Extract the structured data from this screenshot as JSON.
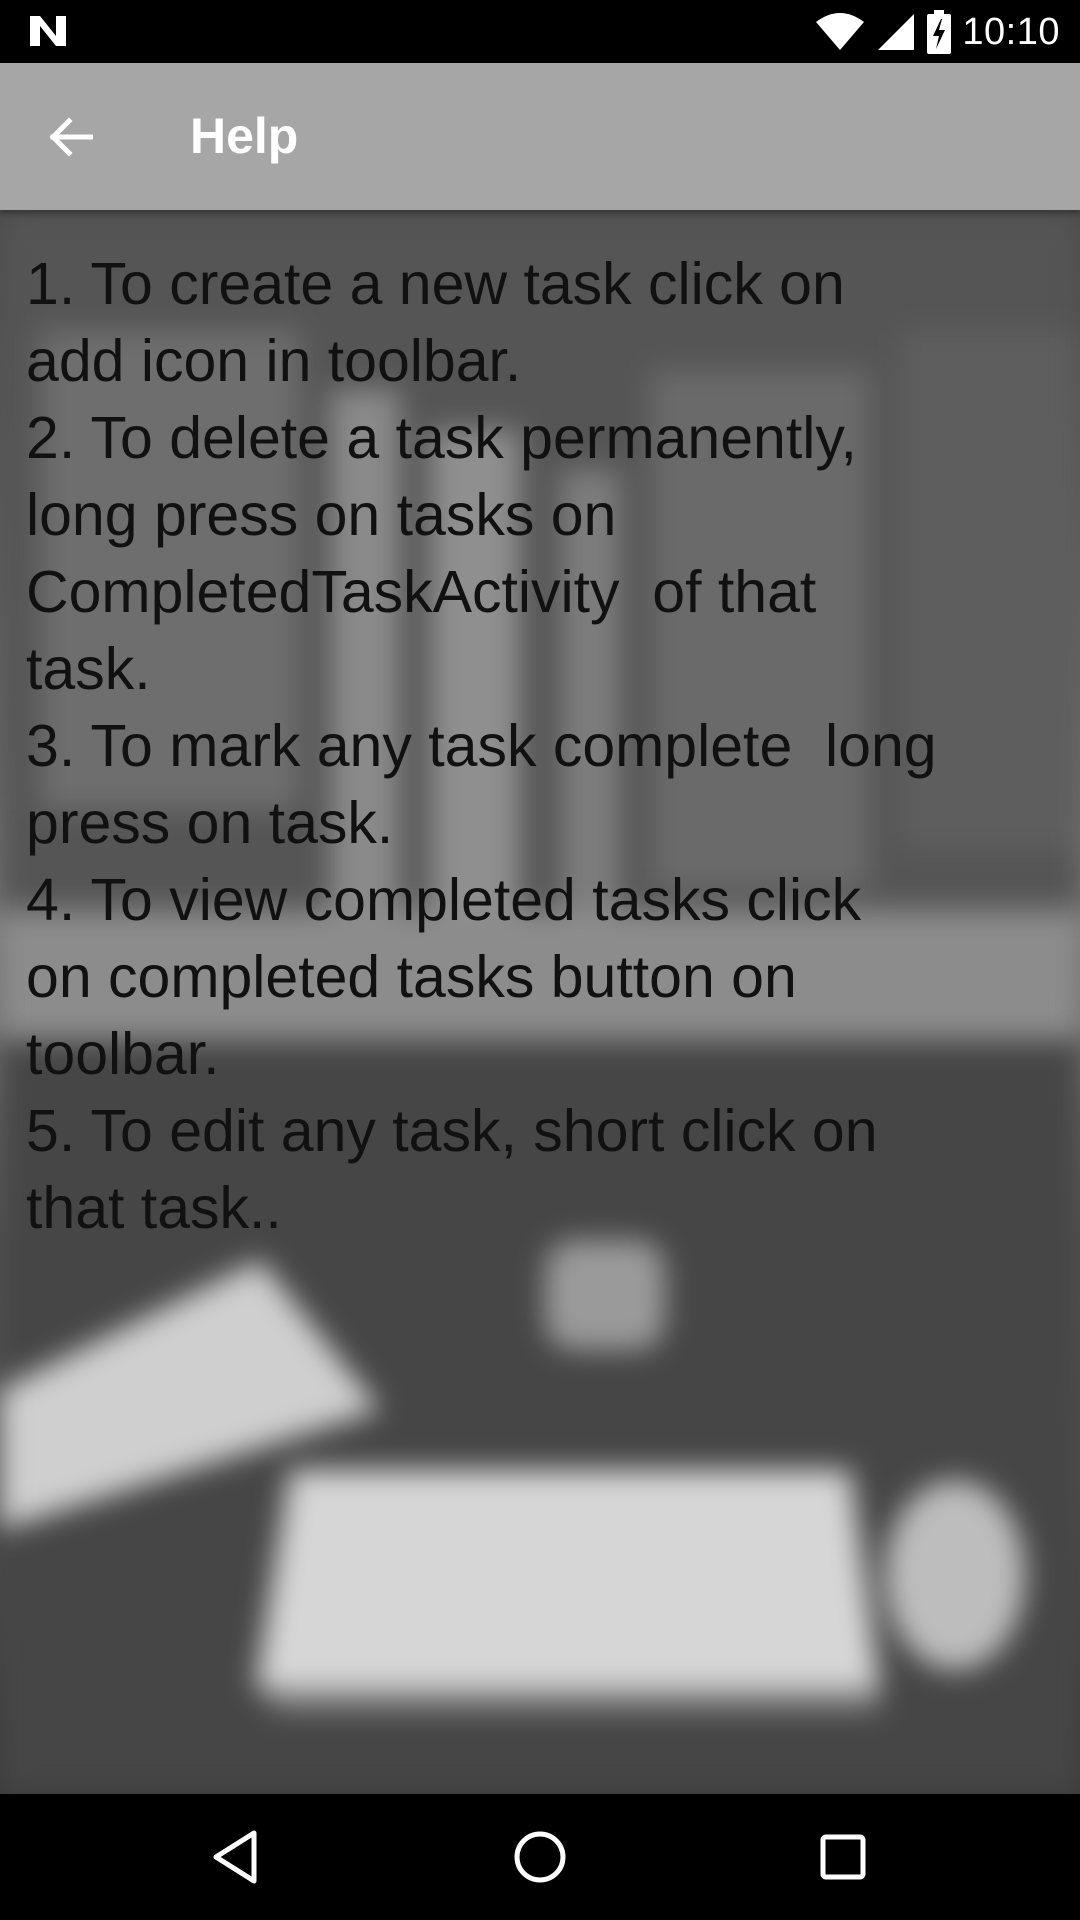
{
  "status_bar": {
    "time": "10:10",
    "icons": [
      "android-n-logo-icon",
      "wifi-icon",
      "cell-signal-icon",
      "battery-charging-icon"
    ]
  },
  "toolbar": {
    "back_icon": "arrow-back-icon",
    "title": "Help",
    "background_color": "#a6a6a6"
  },
  "content": {
    "help_text": "1. To create a new task click on\nadd icon in toolbar.\n2. To delete a task permanently,\nlong press on tasks on\nCompletedTaskActivity  of that\ntask.\n3. To mark any task complete  long\npress on task.\n4. To view completed tasks click\non completed tasks button on\ntoolbar.\n5. To edit any task, short click on\nthat task.."
  },
  "nav_bar": {
    "icons": [
      "back-triangle-icon",
      "home-circle-icon",
      "recents-square-icon"
    ]
  }
}
